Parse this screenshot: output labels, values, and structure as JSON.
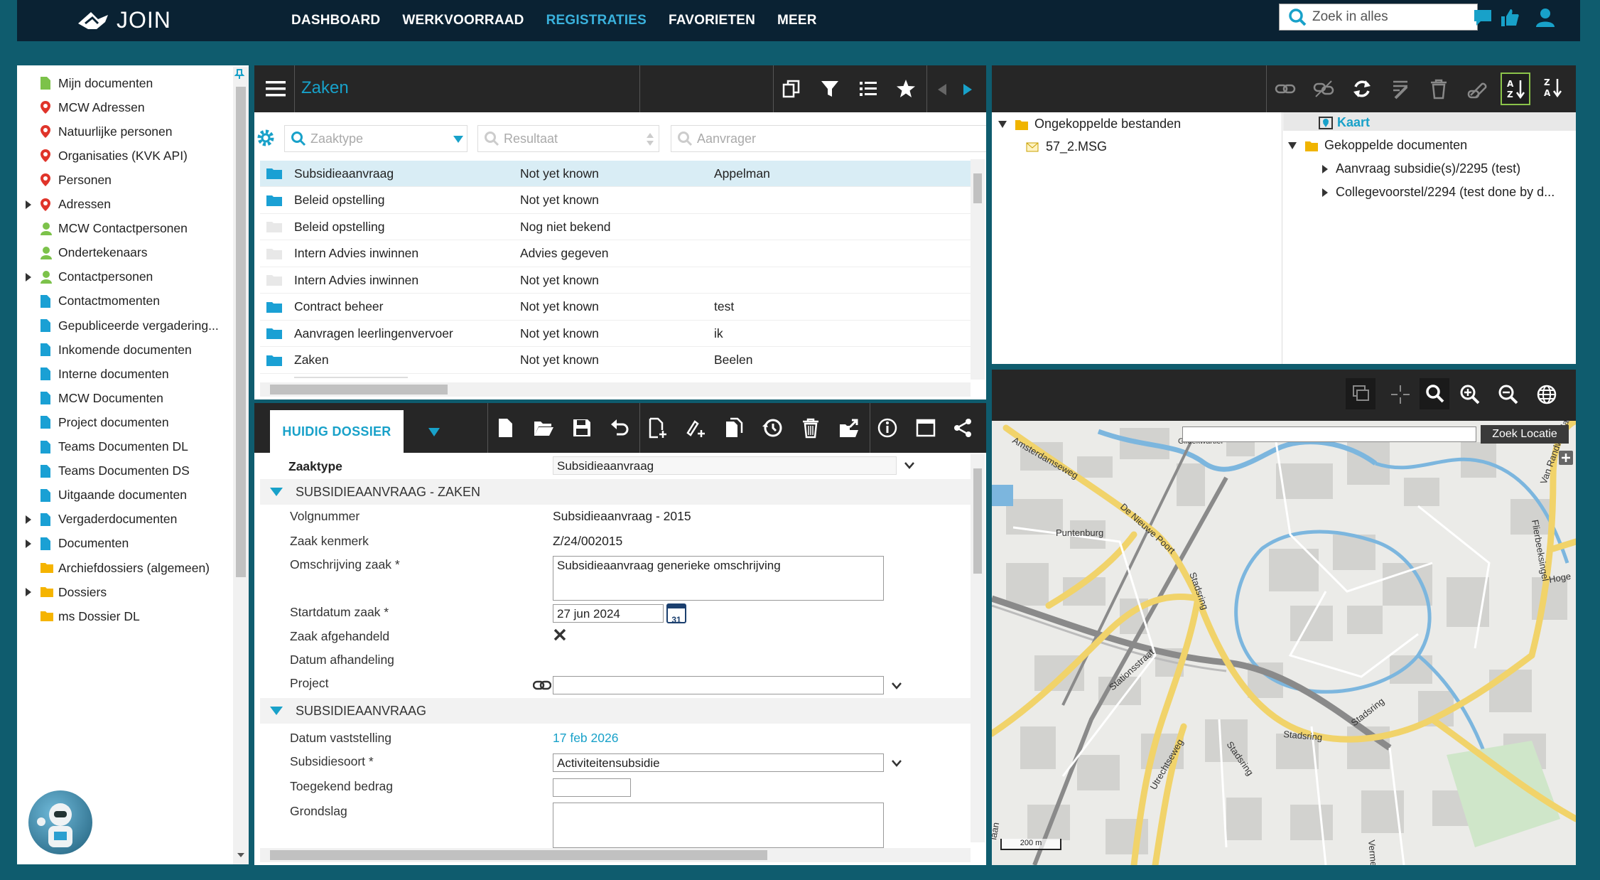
{
  "app": {
    "name": "JOIN"
  },
  "nav": [
    "DASHBOARD",
    "WERKVOORRAAD",
    "REGISTRATIES",
    "FAVORIETEN",
    "MEER"
  ],
  "search": {
    "placeholder": "Zoek in alles"
  },
  "sidebar": {
    "items": [
      {
        "label": "Mijn documenten",
        "icon": "doc-icon-green",
        "expand": false
      },
      {
        "label": "MCW Adressen",
        "icon": "map-pin-icon",
        "expand": false
      },
      {
        "label": "Natuurlijke personen",
        "icon": "map-pin-icon",
        "expand": false
      },
      {
        "label": "Organisaties (KVK API)",
        "icon": "map-pin-icon",
        "expand": false
      },
      {
        "label": "Personen",
        "icon": "map-pin-icon",
        "expand": false
      },
      {
        "label": "Adressen",
        "icon": "map-pin-icon",
        "expand": true
      },
      {
        "label": "MCW Contactpersonen",
        "icon": "person-icon",
        "expand": false
      },
      {
        "label": "Ondertekenaars",
        "icon": "person-icon",
        "expand": false
      },
      {
        "label": "Contactpersonen",
        "icon": "person-icon",
        "expand": true
      },
      {
        "label": "Contactmomenten",
        "icon": "doc-icon",
        "expand": false
      },
      {
        "label": "Gepubliceerde vergadering...",
        "icon": "doc-icon",
        "expand": false
      },
      {
        "label": "Inkomende documenten",
        "icon": "doc-icon",
        "expand": false
      },
      {
        "label": "Interne documenten",
        "icon": "doc-icon",
        "expand": false
      },
      {
        "label": "MCW Documenten",
        "icon": "doc-icon",
        "expand": false
      },
      {
        "label": "Project documenten",
        "icon": "doc-icon",
        "expand": false
      },
      {
        "label": "Teams Documenten DL",
        "icon": "doc-icon",
        "expand": false
      },
      {
        "label": "Teams Documenten DS",
        "icon": "doc-icon",
        "expand": false
      },
      {
        "label": "Uitgaande documenten",
        "icon": "doc-icon",
        "expand": false
      },
      {
        "label": "Vergaderdocumenten",
        "icon": "doc-icon",
        "expand": true
      },
      {
        "label": "Documenten",
        "icon": "doc-icon",
        "expand": true
      },
      {
        "label": "Archiefdossiers (algemeen)",
        "icon": "folder-icon",
        "expand": false
      },
      {
        "label": "Dossiers",
        "icon": "folder-icon",
        "expand": true
      },
      {
        "label": "ms Dossier DL",
        "icon": "folder-icon",
        "expand": false
      }
    ]
  },
  "zaken": {
    "title": "Zaken",
    "filters": {
      "zaaktype": "Zaaktype",
      "resultaat": "Resultaat",
      "aanvrager": "Aanvrager"
    },
    "rows": [
      {
        "c1": "Subsidieaanvraag",
        "c2": "Not yet known",
        "c3": "Appelman",
        "folder": "blue",
        "selected": true
      },
      {
        "c1": "Beleid opstelling",
        "c2": "Not yet known",
        "c3": "",
        "folder": "blue",
        "selected": false
      },
      {
        "c1": "Beleid opstelling",
        "c2": "Nog niet bekend",
        "c3": "",
        "folder": "grey",
        "selected": false
      },
      {
        "c1": "Intern Advies inwinnen",
        "c2": "Advies gegeven",
        "c3": "",
        "folder": "grey",
        "selected": false
      },
      {
        "c1": "Intern Advies inwinnen",
        "c2": "Not yet known",
        "c3": "",
        "folder": "grey",
        "selected": false
      },
      {
        "c1": "Contract beheer",
        "c2": "Not yet known",
        "c3": "test",
        "folder": "blue",
        "selected": false
      },
      {
        "c1": "Aanvragen leerlingenvervoer",
        "c2": "Not yet known",
        "c3": "ik",
        "folder": "blue",
        "selected": false
      },
      {
        "c1": "Zaken",
        "c2": "Not yet known",
        "c3": "Beelen",
        "folder": "blue",
        "selected": false
      }
    ]
  },
  "detail": {
    "tab": "HUIDIG DOSSIER",
    "zaaktype_label": "Zaaktype",
    "zaaktype_value": "Subsidieaanvraag",
    "section1": "SUBSIDIEAANVRAAG -  ZAKEN",
    "volgnummer_label": "Volgnummer",
    "volgnummer_value": "Subsidieaanvraag - 2015",
    "kenmerk_label": "Zaak kenmerk",
    "kenmerk_value": "Z/24/002015",
    "omschrijving_label": "Omschrijving zaak *",
    "omschrijving_value": "Subsidieaanvraag generieke omschrijving",
    "startdatum_label": "Startdatum zaak *",
    "startdatum_value": "27 jun 2024",
    "calendar_day": "31",
    "afgehandeld_label": "Zaak afgehandeld",
    "datum_afhandeling_label": "Datum afhandeling",
    "project_label": "Project",
    "section2": "SUBSIDIEAANVRAAG",
    "vaststelling_label": "Datum vaststelling",
    "vaststelling_value": "17 feb 2026",
    "subsidiesoort_label": "Subsidiesoort *",
    "subsidiesoort_value": "Activiteitensubsidie",
    "bedrag_label": "Toegekend bedrag",
    "grondslag_label": "Grondslag"
  },
  "docs": {
    "unlinked": "Ongekoppelde bestanden",
    "file1": "57_2.MSG",
    "map_link": "Kaart",
    "linked": "Gekoppelde documenten",
    "doc1": "Aanvraag subsidie(s)/2295 (test)",
    "doc2": "Collegevoorstel/2294 (test done by d..."
  },
  "map": {
    "search_button": "Zoek Locatie",
    "scale": "200 m",
    "streets": [
      "Amsterdamseweg",
      "De Nieuwe Poort",
      "Stadsring",
      "Stationsstraat",
      "Utrechtseweg",
      "Stadsring",
      "Stadsring",
      "Stadsring",
      "Puntenburg",
      "Van Randwijcklaan",
      "Flierbeeksingel",
      "Hoge",
      "Gildekwartier",
      "Verme",
      "laan"
    ]
  },
  "colors": {
    "accent": "#18a1c9",
    "topbar": "#0a2233",
    "background": "#0f5c6e",
    "toolbar": "#262626"
  }
}
